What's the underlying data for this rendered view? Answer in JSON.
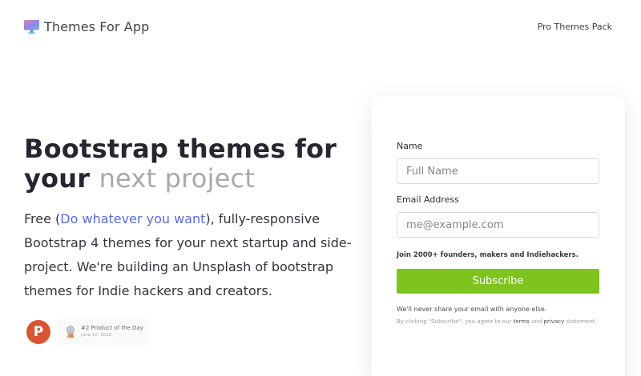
{
  "brand": {
    "name": "Themes For App",
    "icon": "monitor-icon",
    "icon_colors": [
      "#f07fa0",
      "#8a7de8",
      "#58c7e6"
    ]
  },
  "nav": {
    "link_label": "Pro Themes Pack"
  },
  "hero": {
    "headline_bold_1": "Bootstrap themes for",
    "headline_bold_2": "your",
    "headline_muted": "next project",
    "lead_prefix": "Free (",
    "lead_link": "Do whatever you want",
    "lead_suffix": "), fully-responsive Bootstrap 4 themes for your next startup and side-project. We're building an Unsplash of bootstrap themes for Indie hackers and creators."
  },
  "badges": {
    "producthunt_letter": "P",
    "award_title": "#2 Product of the Day",
    "award_date": "June 10, 2018"
  },
  "form": {
    "name_label": "Name",
    "name_placeholder": "Full Name",
    "email_label": "Email Address",
    "email_placeholder": "me@example.com",
    "join_text": "Join 2000+ founders, makers and Indiehackers.",
    "submit_label": "Subscribe",
    "privacy_note": "We'll never share your email with anyone else.",
    "legal_prefix": "By clicking \"Subscribe\", you agree to our",
    "terms_link": "terms",
    "and_text": "and",
    "privacy_link": "privacy",
    "legal_suffix": "statement."
  },
  "colors": {
    "accent_link": "#5a6be3",
    "button": "#7fc31f",
    "producthunt": "#d95432"
  }
}
